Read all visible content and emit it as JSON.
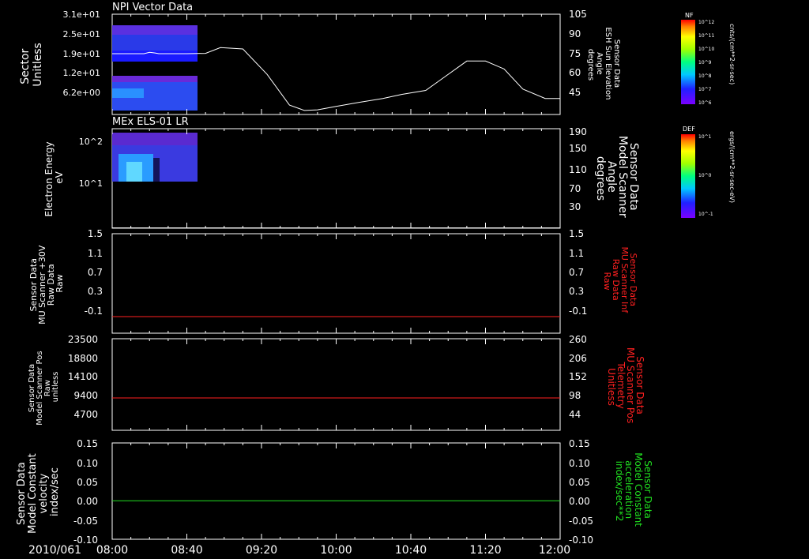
{
  "date_label": "2010/061",
  "time_ticks": [
    "08:00",
    "08:40",
    "09:20",
    "10:00",
    "10:40",
    "11:20",
    "12:00"
  ],
  "time_range_min": [
    480,
    720
  ],
  "colors": {
    "white": "#ffffff",
    "red": "#ff2020",
    "green": "#20e020",
    "black": "#000000"
  },
  "chart_data": [
    {
      "type": "heatmap",
      "title": "NPI Vector Data",
      "ylabel_lines": [
        "Sector",
        "Unitless"
      ],
      "yticks": [
        "3.1e+01",
        "2.5e+01",
        "1.9e+01",
        "1.2e+01",
        "6.2e+00"
      ],
      "yticks_right": [
        "105",
        "90",
        "75",
        "60",
        "45"
      ],
      "ylim_right": [
        30,
        105
      ],
      "ylabel_right_lines": [
        "Sensor Data",
        "ESH Sun Elevation",
        "Angle",
        "degrees"
      ],
      "ylabel_right_color": "#ffffff",
      "overlay": {
        "name": "ESH Sun Elevation Angle",
        "x_min": [
          480,
          497,
          500,
          503,
          505,
          520,
          530,
          538,
          550,
          563,
          575,
          583,
          590,
          600,
          612,
          625,
          635,
          648,
          658,
          670,
          680,
          690,
          700,
          712,
          720
        ],
        "y": [
          75.5,
          75.5,
          76.5,
          76,
          75.5,
          75.5,
          75.7,
          80,
          79,
          60,
          37,
          33,
          33.5,
          36,
          39,
          42,
          45,
          48,
          58,
          70,
          70,
          64,
          49,
          42,
          42
        ]
      },
      "heatmap_data": {
        "x_range_min": [
          480,
          524
        ],
        "bands": [
          "1.9e+01 - 3.1e+01",
          "6.2e+00 - 1.2e+01"
        ]
      },
      "colorbar": {
        "label": "NF",
        "unit": "cnts/(cm**2-sr-sec)",
        "tick_labels": [
          "10^12",
          "10^11",
          "10^10",
          "10^9",
          "10^8",
          "10^7",
          "10^6"
        ]
      }
    },
    {
      "type": "heatmap",
      "title": "MEx ELS-01 LR",
      "ylabel_lines": [
        "Electron Energy",
        "eV"
      ],
      "yticks": [
        "10^2",
        "10^1"
      ],
      "ylim": [
        1,
        200
      ],
      "yticks_right": [
        "190",
        "150",
        "110",
        "70",
        "30"
      ],
      "ylim_right": [
        10,
        190
      ],
      "ylabel_right_lines": [
        "Sensor Data",
        "Model Scanner",
        "Angle",
        "degrees"
      ],
      "ylabel_right_color": "#ffffff",
      "overlay": {
        "name": "Model Scanner Angle",
        "x_min": [
          480,
          720
        ],
        "y": [
          10.5,
          10.5
        ]
      },
      "heatmap_data": {
        "x_range_min": [
          480,
          524
        ],
        "energy_range_eV": [
          10,
          150
        ]
      },
      "colorbar": {
        "label": "DEF",
        "unit": "ergs/(cm**2-sr-sec-eV)",
        "tick_labels": [
          "10^1",
          "10^0",
          "10^-1"
        ]
      }
    },
    {
      "type": "line",
      "ylabel_lines": [
        "Sensor Data",
        "MU Scanner +30V",
        "Raw Data",
        "Raw"
      ],
      "yticks": [
        "1.5",
        "1.1",
        "0.7",
        "0.3",
        "-0.1"
      ],
      "ylim": [
        -0.3,
        1.5
      ],
      "yticks_right": [
        "1.5",
        "1.1",
        "0.7",
        "0.3",
        "-0.1"
      ],
      "ylabel_right_lines": [
        "Sensor Data",
        "MU Scanner Inf",
        "Raw Data",
        "Raw"
      ],
      "ylabel_right_color": "#ff2020",
      "series": [
        {
          "name": "Sensor Data MU Scanner Inf Raw Data",
          "color": "#ff2020",
          "x_min": [
            480,
            720
          ],
          "y": [
            0.0,
            0.0
          ]
        }
      ]
    },
    {
      "type": "line",
      "ylabel_lines": [
        "Sensor Data",
        "Model Scanner Pos",
        "Raw",
        "unitless"
      ],
      "yticks": [
        "23500",
        "18800",
        "14100",
        "9400",
        "4700"
      ],
      "ylim": [
        0,
        23500
      ],
      "yticks_right": [
        "260",
        "206",
        "152",
        "98",
        "44"
      ],
      "ylabel_right_lines": [
        "Sensor Data",
        "MU Scanner Pos",
        "Telemetry",
        "Unitless"
      ],
      "ylabel_right_color": "#ff2020",
      "series": [
        {
          "name": "Sensor Data MU Scanner Pos Telemetry",
          "color": "#ff2020",
          "x_min": [
            480,
            720
          ],
          "y": [
            8300,
            8300
          ]
        }
      ]
    },
    {
      "type": "line",
      "ylabel_lines": [
        "Sensor Data",
        "Model Constant",
        "velocity",
        "index/sec"
      ],
      "yticks": [
        "0.15",
        "0.10",
        "0.05",
        "0.00",
        "-0.05",
        "-0.10"
      ],
      "ylim": [
        -0.1,
        0.15
      ],
      "yticks_right": [
        "0.15",
        "0.10",
        "0.05",
        "0.00",
        "-0.05",
        "-0.10"
      ],
      "ylabel_right_lines": [
        "Sensor Data",
        "Model Constant",
        "acceleration",
        "index/sec**2"
      ],
      "ylabel_right_color": "#20e020",
      "series": [
        {
          "name": "Sensor Data Model Constant acceleration",
          "color": "#20e020",
          "x_min": [
            480,
            720
          ],
          "y": [
            0.0,
            0.0
          ]
        }
      ]
    }
  ]
}
